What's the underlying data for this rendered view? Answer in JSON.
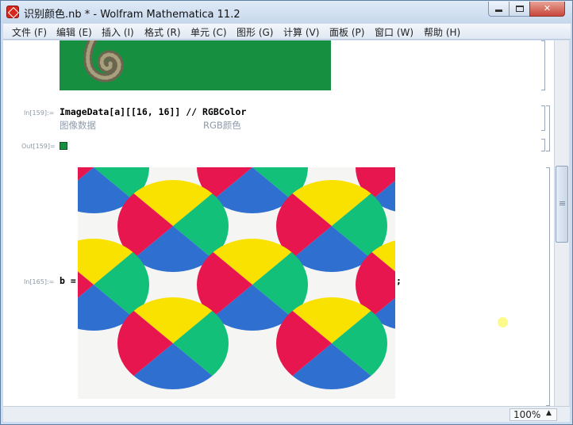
{
  "window": {
    "title": "识别颜色.nb * - Wolfram Mathematica 11.2",
    "minimize_glyph": "",
    "maximize_glyph": "",
    "close_glyph": "✕"
  },
  "menu": [
    "文件 (F)",
    "编辑 (E)",
    "插入 (I)",
    "格式 (R)",
    "单元 (C)",
    "图形 (G)",
    "计算 (V)",
    "面板 (P)",
    "窗口 (W)",
    "帮助 (H)"
  ],
  "cells": {
    "in159_label": "In[159]:=",
    "in159_code": "ImageData[a][[16, 16]] // RGBColor",
    "in159_hint_left": "图像数据",
    "in159_hint_right": "RGB颜色",
    "out159_label": "Out[159]=",
    "out159_color": "#169040",
    "in165_label": "In[165]:=",
    "in165_prefix": "b =",
    "in165_suffix": ";"
  },
  "pattern_colors": {
    "red": "#e8164f",
    "yellow": "#f9e200",
    "green": "#12c07a",
    "blue": "#2f6fd0",
    "background": "#f5f5f3"
  },
  "status": {
    "zoom": "100%",
    "zoom_arrow": "▲"
  }
}
